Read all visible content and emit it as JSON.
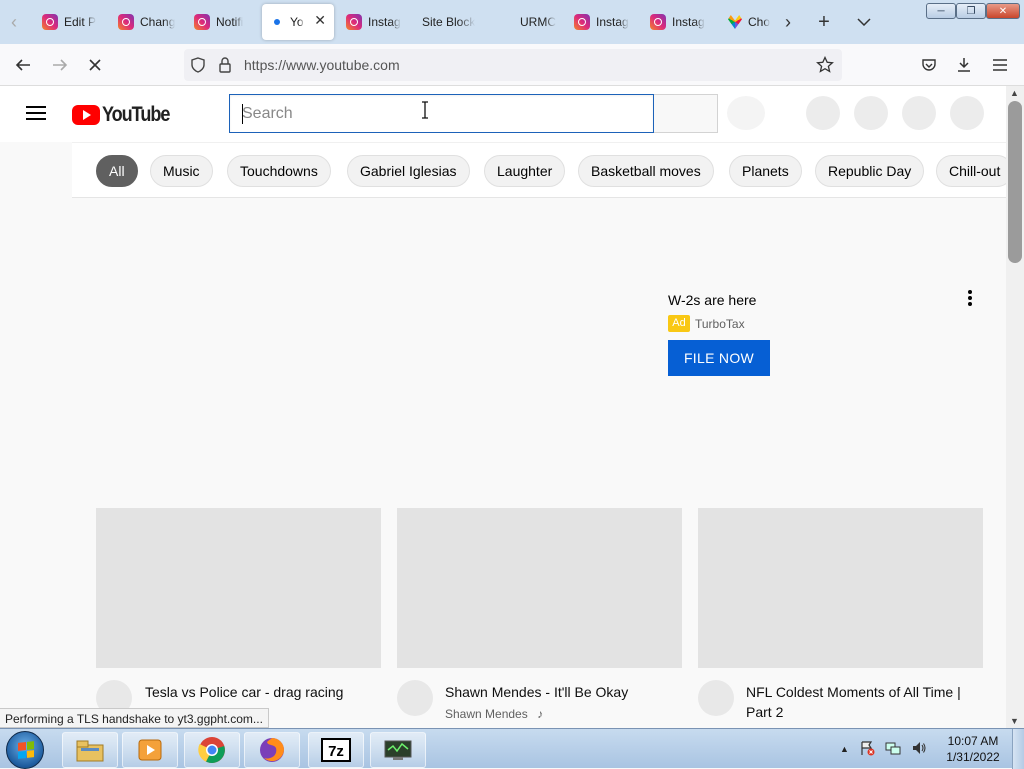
{
  "browser": {
    "tabs": [
      {
        "label": "Edit P",
        "favicon": "instagram-icon"
      },
      {
        "label": "Chang",
        "favicon": "instagram-icon"
      },
      {
        "label": "Notifi",
        "favicon": "instagram-icon"
      },
      {
        "label": "Yo",
        "favicon": "loading-dot-icon",
        "active": true
      },
      {
        "label": "Instag",
        "favicon": "instagram-icon"
      },
      {
        "label": "Site Block",
        "favicon": ""
      },
      {
        "label": "URMC",
        "favicon": ""
      },
      {
        "label": "Instag",
        "favicon": "instagram-icon"
      },
      {
        "label": "Instag",
        "favicon": "instagram-icon"
      },
      {
        "label": "Cho",
        "favicon": "nbc-peacock-icon"
      }
    ],
    "url": "https://www.youtube.com",
    "status_text": "Performing a TLS handshake to yt3.ggpht.com..."
  },
  "youtube": {
    "logo_text": "YouTube",
    "search_placeholder": "Search",
    "chips": [
      "All",
      "Music",
      "Touchdowns",
      "Gabriel Iglesias",
      "Laughter",
      "Basketball moves",
      "Planets",
      "Republic Day",
      "Chill-out"
    ],
    "selected_chip": "All",
    "ad": {
      "title": "W-2s are here",
      "badge": "Ad",
      "advertiser": "TurboTax",
      "cta": "FILE NOW"
    },
    "videos": [
      {
        "title": "Tesla vs Police car - drag racing",
        "channel": ""
      },
      {
        "title": "Shawn Mendes - It'll Be Okay",
        "channel": "Shawn Mendes",
        "channel_badge": "music-note-icon"
      },
      {
        "title": "NFL Coldest Moments of All Time | Part 2",
        "channel": ""
      }
    ]
  },
  "taskbar": {
    "apps": [
      "windows-explorer-icon",
      "media-player-icon",
      "chrome-icon",
      "firefox-icon",
      "7zip-icon",
      "monitor-app-icon"
    ],
    "clock_time": "10:07 AM",
    "clock_date": "1/31/2022"
  },
  "colors": {
    "youtube_red": "#ff0000",
    "cta_blue": "#065fd4",
    "ad_badge": "#f9c814",
    "search_focus": "#1c62b9"
  }
}
